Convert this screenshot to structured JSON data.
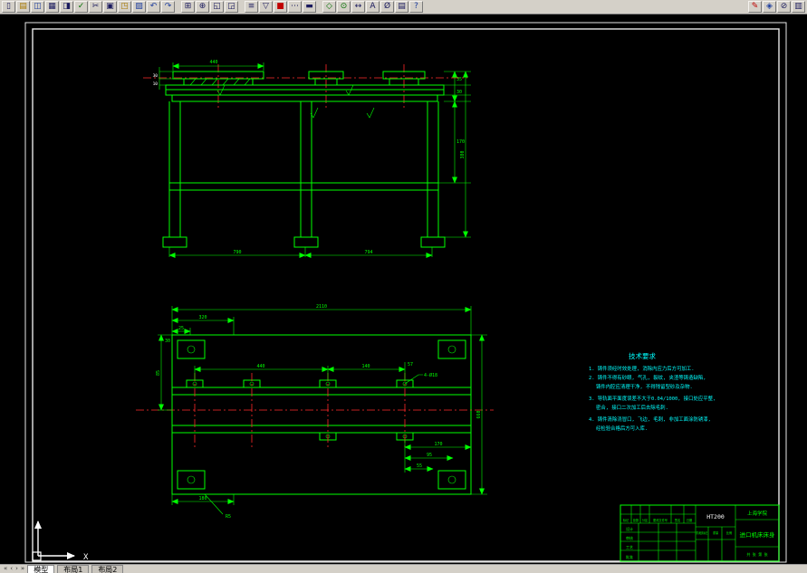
{
  "toolbar": {
    "icons": [
      {
        "name": "new",
        "glyph": "▯"
      },
      {
        "name": "open",
        "glyph": "▤"
      },
      {
        "name": "save",
        "glyph": "◫"
      },
      {
        "name": "print",
        "glyph": "▦"
      },
      {
        "name": "preview",
        "glyph": "◨"
      },
      {
        "name": "spell",
        "glyph": "✓"
      },
      {
        "name": "cut",
        "glyph": "✂"
      },
      {
        "name": "copy",
        "glyph": "▣"
      },
      {
        "name": "paste",
        "glyph": "◳"
      },
      {
        "name": "match-properties",
        "glyph": "▨"
      },
      {
        "name": "undo",
        "glyph": "↶"
      },
      {
        "name": "redo",
        "glyph": "↷"
      },
      {
        "name": "pan",
        "glyph": "⊞"
      },
      {
        "name": "zoom",
        "glyph": "⊕"
      },
      {
        "name": "zoom-window",
        "glyph": "◱"
      },
      {
        "name": "zoom-previous",
        "glyph": "◲"
      },
      {
        "name": "layers",
        "glyph": "≡"
      },
      {
        "name": "layer-control",
        "glyph": "▽"
      },
      {
        "name": "color",
        "glyph": "■"
      },
      {
        "name": "linetype",
        "glyph": "⋯"
      },
      {
        "name": "lineweight",
        "glyph": "▬"
      },
      {
        "name": "insert",
        "glyph": "◇"
      },
      {
        "name": "osnap",
        "glyph": "⊙"
      },
      {
        "name": "dimension",
        "glyph": "↔"
      },
      {
        "name": "text",
        "glyph": "A"
      },
      {
        "name": "measure",
        "glyph": "Ø"
      },
      {
        "name": "properties",
        "glyph": "▤"
      },
      {
        "name": "help",
        "glyph": "?"
      },
      {
        "name": "express-a",
        "glyph": "✎"
      },
      {
        "name": "express-b",
        "glyph": "◈"
      },
      {
        "name": "express-c",
        "glyph": "⊘"
      },
      {
        "name": "express-d",
        "glyph": "▥"
      }
    ]
  },
  "top_view": {
    "dims": {
      "d440": "440",
      "d30l": "30",
      "d10l": "10",
      "d35": "35",
      "d30r": "30",
      "d170": "170",
      "d380": "380",
      "d790": "790",
      "d794": "794"
    }
  },
  "plan_view": {
    "dims": {
      "d2110": "2110",
      "d320": "320",
      "d25": "25",
      "d440": "440",
      "d140": "140",
      "d57": "57",
      "dphi": "4-Ø18",
      "d660": "660",
      "d85": "85",
      "d30": "30",
      "d170": "170",
      "d95": "95",
      "d55": "55",
      "d180": "180",
      "r5": "R5"
    }
  },
  "notes": {
    "title": "技术要求",
    "lines": [
      "1. 铸件须经时效处理, 消除内应力后方可加工.",
      "2. 铸件不得有砂眼, 气孔, 裂纹, 夹渣等铸造缺陷,",
      "铸件内腔应清理干净, 不得残留型砂及杂物.",
      "3. 导轨面平面度误差不大于0.04/1000, 接口处应平整,",
      "密合, 接口二次加工后去除毛刺.",
      "4. 铸件清除浇冒口, 飞边, 毛刺, 非加工面涂防锈漆,",
      "经检验合格后方可入库."
    ]
  },
  "title_block": {
    "material": "HT200",
    "company": "上海学院",
    "part_name": "进口机床床身",
    "sheet_info": "共 张 第 张",
    "labels": {
      "mark": "标记",
      "count": "处数",
      "zone": "分区",
      "doc_no": "更改文件号",
      "sign": "签名",
      "date": "日期",
      "design": "设计",
      "check": "审核",
      "process": "工艺",
      "approve": "批准",
      "stage": "阶段标记",
      "weight": "重量",
      "scale": "比例"
    }
  },
  "ucs": {
    "x_label": "X"
  },
  "tabs": {
    "nav": [
      "«",
      "‹",
      "›",
      "»"
    ],
    "model": "模型",
    "layout1": "布局1",
    "layout2": "布局2"
  }
}
